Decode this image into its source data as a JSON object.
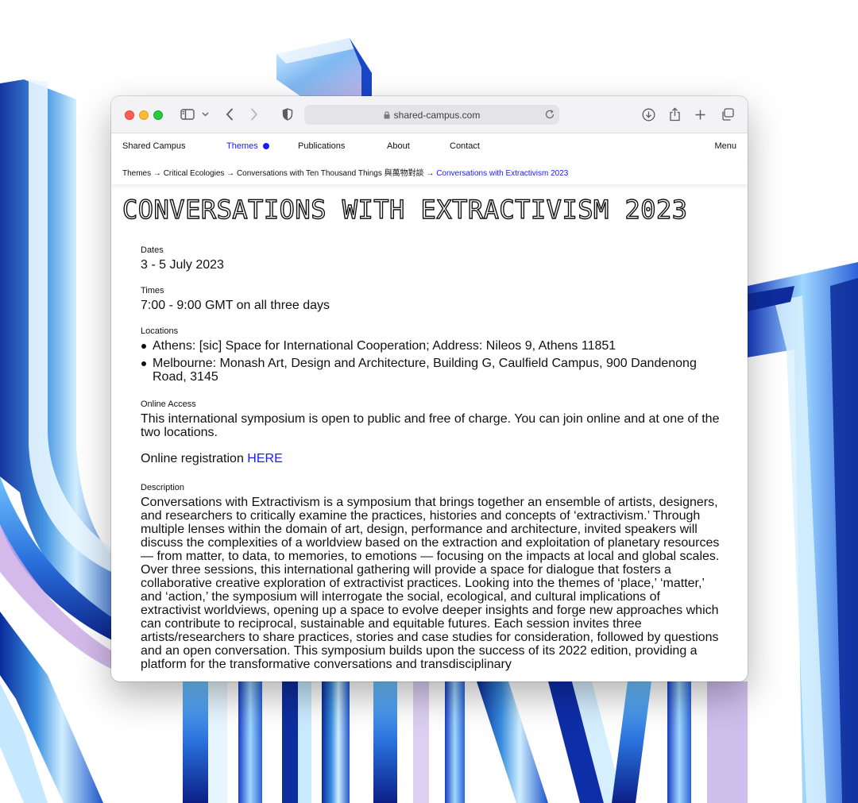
{
  "browser": {
    "url": "shared-campus.com"
  },
  "nav": {
    "brand": "Shared Campus",
    "themes": "Themes",
    "publications": "Publications",
    "about": "About",
    "contact": "Contact",
    "menu": "Menu"
  },
  "breadcrumb": {
    "items": [
      "Themes →",
      "Critical Ecologies →",
      "Conversations with Ten Thousand Things 與萬物對談 →"
    ],
    "current": "Conversations with Extractivism 2023"
  },
  "page": {
    "title": "CONVERSATIONS WITH EXTRACTIVISM 2023",
    "dates_label": "Dates",
    "dates": "3 - 5 July 2023",
    "times_label": "Times",
    "times": "7:00 - 9:00 GMT on all three days",
    "locations_label": "Locations",
    "locations": [
      "Athens: [sic] Space for International Cooperation; Address: Nileos 9, Athens 11851",
      "Melbourne: Monash Art, Design and Architecture, Building G, Caulfield Campus, 900 Dandenong Road, 3145"
    ],
    "online_label": "Online Access",
    "online_text": "This international symposium is open to public and free of charge. You can join online and at one of the two locations.",
    "registration_text": "Online registration",
    "registration_link": "HERE",
    "description_label": "Description",
    "description": "Conversations with Extractivism is a symposium that brings together an ensemble of artists, designers, and researchers to critically examine the practices, histories and concepts of ‘extractivism.’ Through multiple lenses within the domain of art, design, performance and architecture, invited speakers will discuss the complexities of a worldview based on the extraction and exploitation of planetary resources — from matter, to data, to memories, to emotions — focusing on the impacts at local and global scales. Over three sessions, this international gathering will provide a space for dialogue that fosters a collaborative creative exploration of extractivist practices. Looking into the themes of ‘place,’ ‘matter,’ and ‘action,’ the symposium will interrogate the social, ecological, and cultural implications of extractivist worldviews, opening up a space to evolve deeper insights and forge new approaches which can contribute to reciprocal, sustainable and equitable futures. Each session invites three artists/researchers to share practices, stories and case studies for consideration, followed by questions and an open conversation. This symposium builds upon the success of its 2022 edition, providing a platform for the transformative conversations and transdisciplinary"
  },
  "colors": {
    "accent": "#1a1aff",
    "glass_light": "#bfe6ff",
    "glass_mid": "#3a8fe0",
    "glass_dark": "#0a2a9c"
  }
}
